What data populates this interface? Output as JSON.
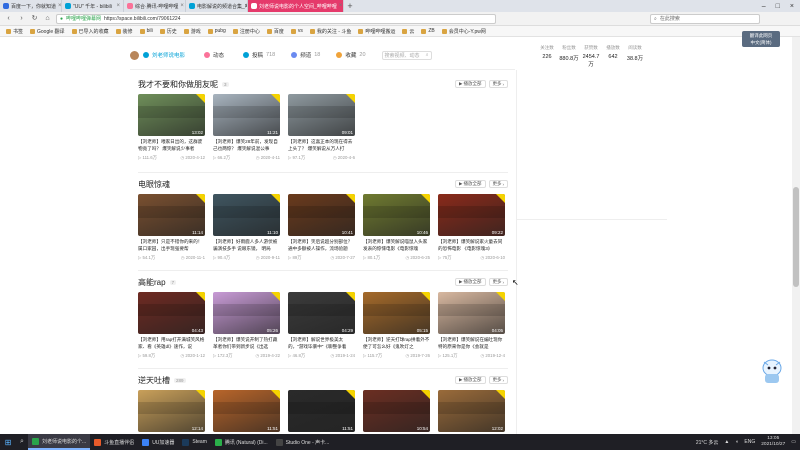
{
  "browser": {
    "tabs": [
      {
        "label": "百度一下，你就知道",
        "color": "#2f6be0",
        "state": "normal"
      },
      {
        "label": "\"UU\" 千年 - bilibili",
        "color": "#00a1d6",
        "state": "normal"
      },
      {
        "label": "综合·腾讯-哔哩哔哩",
        "color": "#fb7299",
        "state": "normal"
      },
      {
        "label": "电影解说的频道合集_哔哩哔哩",
        "color": "#00a1d6",
        "state": "normal"
      },
      {
        "label": "刘老师说电影的个人空间_哔哩哔哩",
        "color": "#ffffff",
        "state": "highlight"
      }
    ],
    "new_tab": "+",
    "url_site": "哔哩哔哩弹幕网",
    "url": "https://space.bilibili.com/79061224",
    "search_placeholder": "在此搜索",
    "window_controls": [
      "–",
      "□",
      "×"
    ]
  },
  "bookmarks": [
    "书签",
    "Google 翻译",
    "已导入的收藏",
    "装修",
    "bili",
    "历史",
    "游戏",
    "pubg",
    "注册中心",
    "百度",
    "vs",
    "我的关注 - 斗鱼",
    "哔哩哔哩搬运",
    "云",
    "ZB",
    "会员中心-Y.pw网"
  ],
  "page_header": {
    "tabs": [
      {
        "label": "刘老师说电影",
        "count": "",
        "color": "#00a1d6",
        "active": true
      },
      {
        "label": "动态",
        "count": "",
        "color": "#fb7299",
        "active": false
      },
      {
        "label": "投稿",
        "count": "718",
        "color": "#00a1d6",
        "active": false
      },
      {
        "label": "频道",
        "count": "18",
        "color": "#6a8af0",
        "active": false
      },
      {
        "label": "收藏",
        "count": "20",
        "color": "#f0a33a",
        "active": false
      }
    ],
    "search_placeholder": "搜索视频、动态"
  },
  "stats": [
    {
      "label": "关注数",
      "value": "226"
    },
    {
      "label": "粉丝数",
      "value": "880.8万"
    },
    {
      "label": "获赞数",
      "value": "2454.7万"
    },
    {
      "label": "播放数",
      "value": "642"
    },
    {
      "label": "阅读数",
      "value": "38.8万"
    }
  ],
  "section_buttons": {
    "play_all": "播放全部",
    "more": "更多"
  },
  "sections": [
    {
      "title": "我才不要和你做朋友呢",
      "count": "3",
      "videos": [
        {
          "title": "【刘老师】喂家日出的，这群废物竟了吗？ 爆笑解说少事者",
          "duration": "13:02",
          "plays": "111.6万",
          "date": "2020-4-12",
          "color": "#6f8f5a"
        },
        {
          "title": "【刘老师】爆笑28年前，发现自己也两惊？ 爆笑解说混公事",
          "duration": "11:21",
          "plays": "66.2万",
          "date": "2020-4-11",
          "color": "#a8b4bf"
        },
        {
          "title": "【刘老师】这喜正本的现在得去上头了？ 爆笑解说从万人打",
          "duration": "09:01",
          "plays": "97.1万",
          "date": "2020-4-6",
          "color": "#8f9aa0"
        }
      ]
    },
    {
      "title": "电眼惊魂",
      "count": "",
      "videos": [
        {
          "title": "【刘老师】只是不错你的来的！ 属口家园，出手现强要帮",
          "duration": "11:14",
          "plays": "54.1万",
          "date": "2020-11-1",
          "color": "#7a5030"
        },
        {
          "title": "【刘老师】好雨鹿人多人游伏被骗演技多手 说眼东镜， 明局",
          "duration": "11:10",
          "plays": "90.4万",
          "date": "2020-9-11",
          "color": "#3f5560"
        },
        {
          "title": "【刘老师】笑后说超分别部位？ 通中多额被人操作，流场验题",
          "duration": "10:41",
          "plays": "89万",
          "date": "2020-7-27",
          "color": "#6a3a1c"
        },
        {
          "title": "【刘老师】爆笑解说喵鼠入头家发表的惊悚电影《电影惊魂",
          "duration": "10:46",
          "plays": "80.1万",
          "date": "2020-6-25",
          "color": "#6f7a30"
        },
        {
          "title": "【刘老师】爆笑解说家火童去同的恐怖电影 《电影惊魂3》",
          "duration": "09:22",
          "plays": "75万",
          "date": "2020-6-10",
          "color": "#8a2a1a"
        }
      ]
    },
    {
      "title": "高能rap",
      "count": "7",
      "videos": [
        {
          "title": "【刘老师】用rap打开满城笑风格家、看《英雄dl》速作，说",
          "duration": "04:43",
          "plays": "59.8万",
          "date": "2020-1-12",
          "color": "#6e2a22"
        },
        {
          "title": "【刘老师】爆笑说开制了热打藏革者你们带到新步说《出选",
          "duration": "05:26",
          "plays": "172.3万",
          "date": "2019-4-22",
          "color": "#c89bd6"
        },
        {
          "title": "【刘老师】解说世界极美太的，\"游戏毕暴中\"《聊整争着",
          "duration": "04:29",
          "plays": "46.8万",
          "date": "2019-1-24",
          "color": "#3b3b3b"
        },
        {
          "title": "【刘老师】逆天打球rap拼着外不便了可怎么好《鬼吹灯之",
          "duration": "05:15",
          "plays": "115.7万",
          "date": "2019-7-26",
          "color": "#a56a2a"
        },
        {
          "title": "【刘老师】爆笑解说在编吐现你特的原来你是你《会就是",
          "duration": "04:05",
          "plays": "125.1万",
          "date": "2019-12-4",
          "color": "#d8b8a0"
        }
      ]
    },
    {
      "title": "逆天吐槽",
      "count": "289",
      "videos": [
        {
          "title": "",
          "duration": "12:14",
          "plays": "",
          "date": "",
          "color": "#c9a05a"
        },
        {
          "title": "",
          "duration": "11:51",
          "plays": "",
          "date": "",
          "color": "#b8652a"
        },
        {
          "title": "",
          "duration": "11:51",
          "plays": "",
          "date": "",
          "color": "#2a2a2a"
        },
        {
          "title": "",
          "duration": "10:54",
          "plays": "",
          "date": "",
          "color": "#6b2e22"
        },
        {
          "title": "",
          "duration": "12:02",
          "plays": "",
          "date": "",
          "color": "#9a6b3a"
        }
      ]
    }
  ],
  "translate_badge": {
    "line1": "翻译此网页",
    "line2": "中文(简体)"
  },
  "taskbar": {
    "apps": [
      {
        "label": "刘老师说电影的个...",
        "color": "#2aa34a",
        "active": true
      },
      {
        "label": "斗鱼直播伴侣",
        "color": "#e85b2a",
        "active": false
      },
      {
        "label": "UU加速器",
        "color": "#3b82f6",
        "active": false
      },
      {
        "label": "Steam",
        "color": "#1b3a5a",
        "active": false
      },
      {
        "label": "腾讯 (Natural) (Di...",
        "color": "#2ab04a",
        "active": false
      },
      {
        "label": "Studio One - 声卡...",
        "color": "#444444",
        "active": false
      }
    ],
    "weather": "21°C 多云",
    "lang": "ENG",
    "time": "13:05",
    "date": "2021/10/27"
  }
}
